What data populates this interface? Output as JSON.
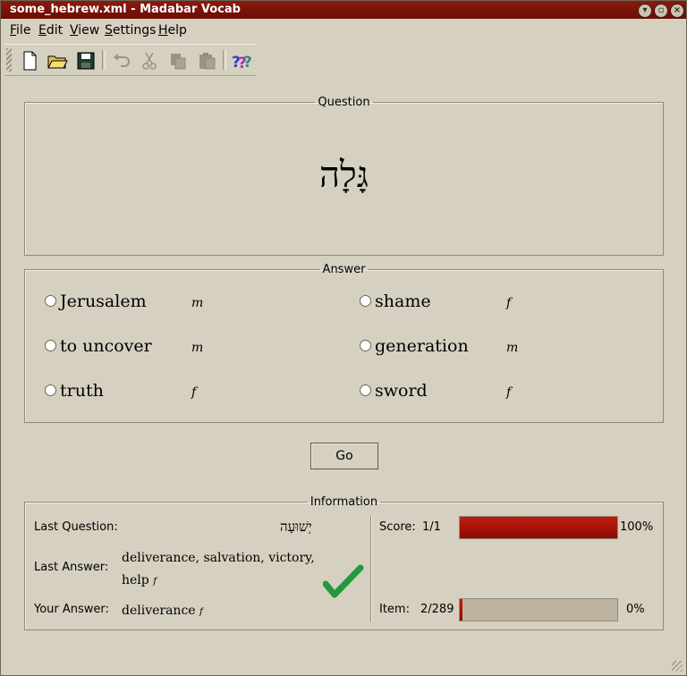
{
  "window": {
    "title": "some_hebrew.xml - Madabar Vocab",
    "controls": [
      "minimize-icon",
      "maximize-icon",
      "close-icon"
    ]
  },
  "menu": [
    "File",
    "Edit",
    "View",
    "Settings",
    "Help"
  ],
  "toolbar": [
    "new-file-icon",
    "open-folder-icon",
    "save-icon",
    "undo-icon",
    "cut-icon",
    "copy-icon",
    "paste-icon",
    "whats-this-help-icon"
  ],
  "question": {
    "legend": "Question",
    "word": "גָּלָה"
  },
  "answer": {
    "legend": "Answer",
    "options": [
      {
        "text": "Jerusalem",
        "gender": "m"
      },
      {
        "text": "shame",
        "gender": "f"
      },
      {
        "text": "to uncover",
        "gender": "m"
      },
      {
        "text": "generation",
        "gender": "m"
      },
      {
        "text": "truth",
        "gender": "f"
      },
      {
        "text": "sword",
        "gender": "f"
      }
    ]
  },
  "go_label": "Go",
  "info": {
    "legend": "Information",
    "last_question_label": "Last Question:",
    "last_question": "יְשׁוּעָה",
    "last_answer_label": "Last Answer:",
    "last_answer_line1": "deliverance, salvation, victory,",
    "last_answer_line2": "help",
    "last_answer_gender": "f",
    "your_answer_label": "Your Answer:",
    "your_answer": "deliverance",
    "your_answer_gender": "f",
    "score_label": "Score:",
    "score_value": "1/1",
    "score_percent": "100%",
    "score_fraction": 1.0,
    "item_label": "Item:",
    "item_value": "2/289",
    "item_percent": "0%",
    "item_fraction": 0.0,
    "result_icon": "checkmark-icon",
    "colors": {
      "progress": "#a8120a",
      "check": "#1f9a3c"
    }
  }
}
